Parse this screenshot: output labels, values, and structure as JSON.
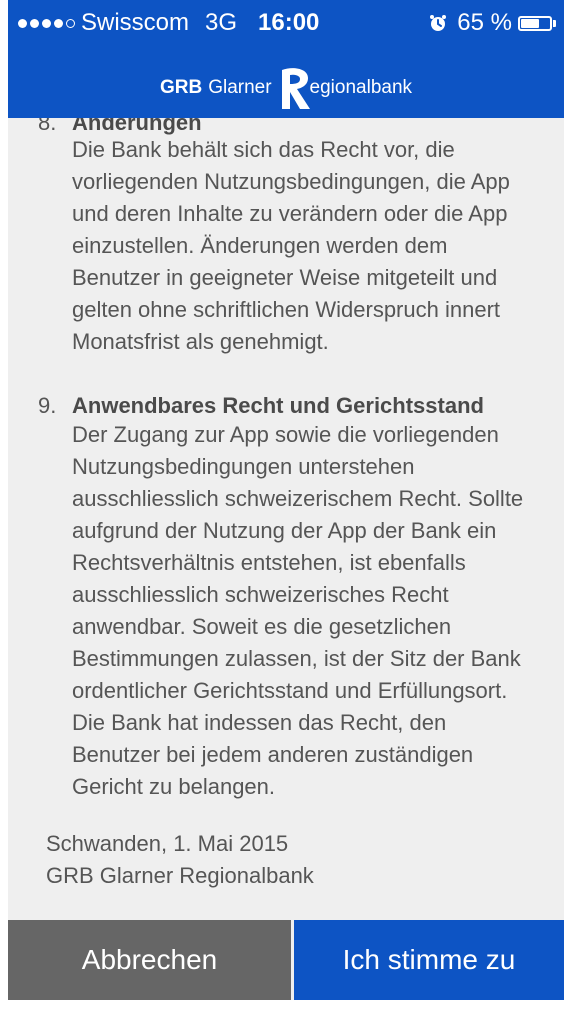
{
  "status_bar": {
    "carrier": "Swisscom",
    "network": "3G",
    "time": "16:00",
    "battery_percent": "65 %",
    "battery_level": 0.65,
    "signal_bars_filled": 4,
    "signal_bars_total": 5
  },
  "header": {
    "logo_abbr": "GRB",
    "logo_name": "Glarner",
    "logo_rest": "egionalbank",
    "background_color": "#0d54c4"
  },
  "sections": [
    {
      "number": "8.",
      "title": "Änderungen",
      "lines": [
        "Die Bank behält sich das Recht vor, die",
        "vorliegenden Nutzungsbedingungen, die App",
        "und deren Inhalte zu verändern oder die App",
        "einzustellen. Änderungen werden dem",
        "Benutzer in geeigneter Weise mitgeteilt und",
        "gelten ohne schriftlichen Widerspruch innert",
        "Monatsfrist als genehmigt."
      ]
    },
    {
      "number": "9.",
      "title": "Anwendbares Recht und Gerichtsstand",
      "lines": [
        "Der Zugang zur App sowie die vorliegenden",
        "Nutzungsbedingungen unterstehen",
        "ausschliesslich schweizerischem Recht. Sollte",
        "aufgrund der Nutzung der App der Bank ein",
        "Rechtsverhältnis entstehen, ist ebenfalls",
        "ausschliesslich schweizerisches Recht",
        "anwendbar. Soweit es die gesetzlichen",
        "Bestimmungen zulassen, ist der Sitz der Bank",
        "ordentlicher Gerichtsstand und Erfüllungsort.",
        "Die Bank hat indessen das Recht, den",
        "Benutzer bei jedem anderen zuständigen",
        "Gericht zu belangen."
      ]
    }
  ],
  "footer": {
    "place_date": "Schwanden, 1. Mai 2015",
    "bank_name": "GRB Glarner Regionalbank"
  },
  "buttons": {
    "cancel": "Abbrechen",
    "agree": "Ich stimme zu"
  }
}
